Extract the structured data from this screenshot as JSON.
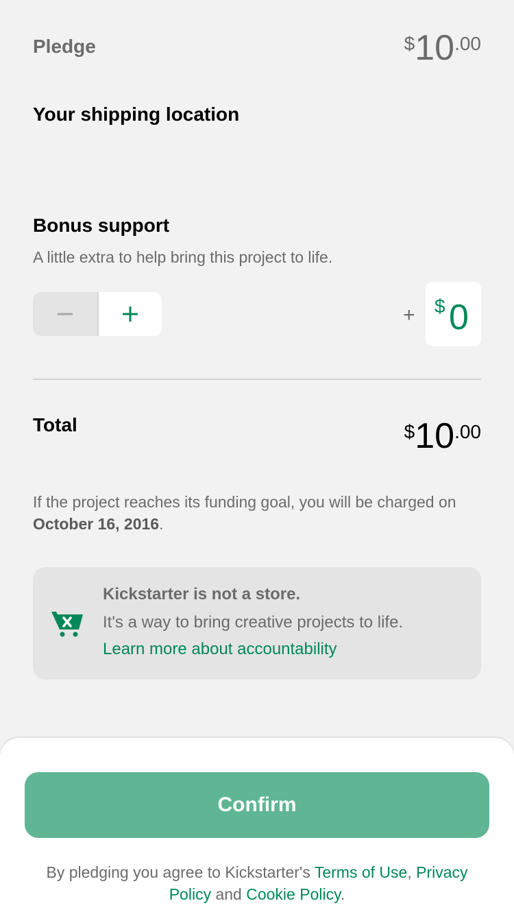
{
  "pledge": {
    "label": "Pledge",
    "amount": {
      "currency": "$",
      "whole": "10",
      "cents": ".00"
    }
  },
  "shipping": {
    "label": "Your shipping location"
  },
  "bonus": {
    "title": "Bonus support",
    "subtitle": "A little extra to help bring this project to life.",
    "plus_sign": "+",
    "amount": {
      "currency": "$",
      "value": "0"
    },
    "minus_icon": "minus-icon",
    "plus_icon": "plus-icon"
  },
  "total": {
    "label": "Total",
    "amount": {
      "currency": "$",
      "whole": "10",
      "cents": ".00"
    }
  },
  "charge_note": {
    "prefix": "If the project reaches its funding goal, you will be charged on ",
    "date": "October 16, 2016",
    "suffix": "."
  },
  "store_notice": {
    "icon": "cart-x-icon",
    "title": "Kickstarter is not a store.",
    "subtitle": "It's a way to bring creative projects to life.",
    "link": "Learn more about accountability"
  },
  "footer": {
    "confirm_label": "Confirm",
    "legal_prefix": "By pledging you agree to Kickstarter's ",
    "terms": "Terms of Use",
    "sep1": ", ",
    "privacy": "Privacy Policy",
    "sep2": " and ",
    "cookie": "Cookie Policy",
    "end": "."
  },
  "colors": {
    "accent": "#028858",
    "confirm_bg": "#5fb594",
    "background": "#f2f2f2",
    "card_bg": "#e4e4e4",
    "muted_text": "#6b6b6b"
  }
}
